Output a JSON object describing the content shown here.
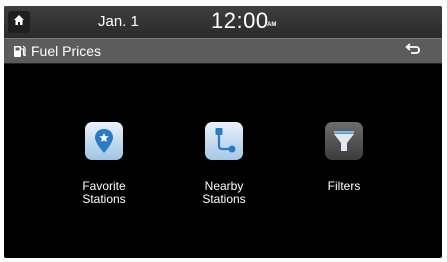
{
  "status": {
    "date": "Jan. 1",
    "time": "12:00",
    "ampm": "AM"
  },
  "header": {
    "title": "Fuel Prices",
    "title_icon": "fuel-pump-icon",
    "back_icon": "back-arrow-icon"
  },
  "options": [
    {
      "label": "Favorite\nStations",
      "icon": "favorite-pin-icon"
    },
    {
      "label": "Nearby\nStations",
      "icon": "nearby-route-icon"
    },
    {
      "label": "Filters",
      "icon": "filter-funnel-icon"
    }
  ],
  "colors": {
    "background": "#000000",
    "status_bar": "#333333",
    "title_bar": "#5c5c5c",
    "icon_blue": "#2b7bc4"
  }
}
